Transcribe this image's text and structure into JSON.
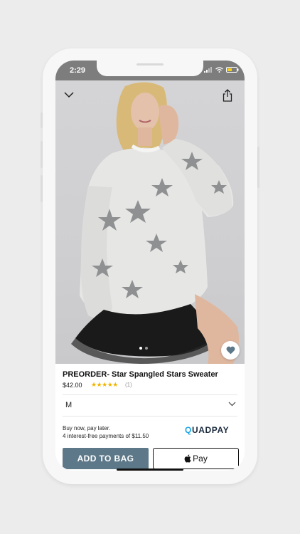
{
  "status": {
    "time": "2:29"
  },
  "product": {
    "title": "PREORDER- Star Spangled Stars Sweater",
    "price": "$42.00",
    "rating_stars": "★★★★★",
    "rating_count": "(1)",
    "images": {
      "count": 2,
      "active": 0
    }
  },
  "size": {
    "selected": "M"
  },
  "payment": {
    "line1": "Buy now, pay later.",
    "line2": "4 interest-free payments of $11.50",
    "brand_q": "Q",
    "brand_rest": "UADPAY"
  },
  "actions": {
    "add_to_bag": "ADD TO BAG",
    "apple_pay": "Pay"
  },
  "colors": {
    "add_button": "#5d7888",
    "rating": "#f3b400",
    "quadpay": "#1ca6e8"
  }
}
